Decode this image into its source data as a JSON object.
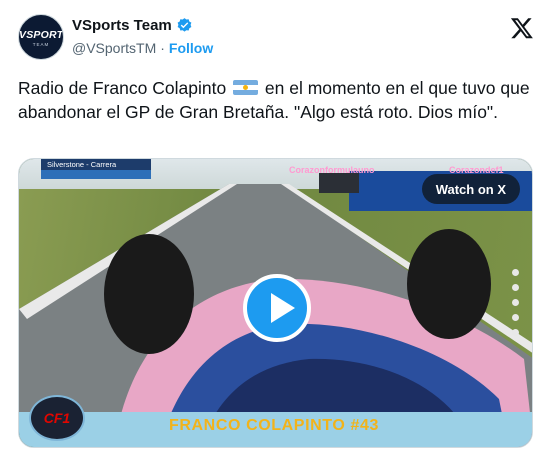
{
  "author": {
    "avatar_text": "VSPORTS",
    "avatar_sub": "TEAM",
    "display_name": "VSports Team",
    "handle": "@VSportsTM",
    "follow_label": "Follow",
    "verified": true
  },
  "tweet": {
    "text_before_flag": "Radio de Franco Colapinto",
    "text_after_flag": " en el momento en el que tuvo que abandonar el GP de Gran Bretaña. \"Algo está roto. Dios mío\".",
    "flag_emoji": "argentina-flag"
  },
  "media": {
    "watch_label": "Watch on X",
    "overlay_track": "Silverstone - Carrera",
    "watermark_1": "Corazonformulauno",
    "watermark_2": "Corazondef1",
    "f1_logo": "F1",
    "bottom_title": "FRANCO COLAPINTO #43",
    "bottom_logo": "CF1"
  },
  "colors": {
    "accent": "#1d9bf0",
    "text_primary": "#0f1419",
    "text_secondary": "#536471"
  }
}
